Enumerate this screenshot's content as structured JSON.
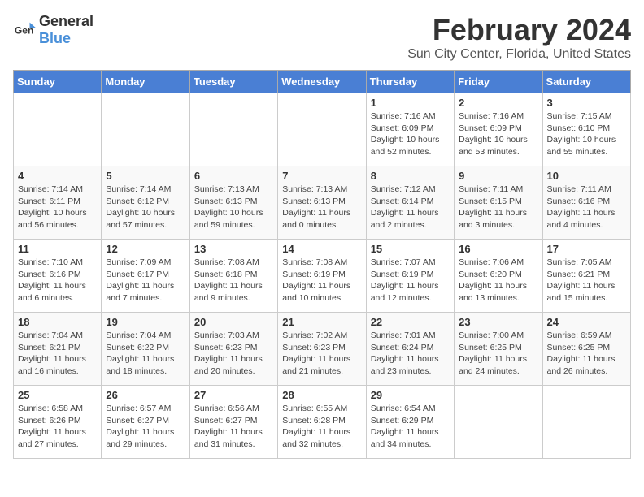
{
  "logo": {
    "general": "General",
    "blue": "Blue"
  },
  "title": "February 2024",
  "subtitle": "Sun City Center, Florida, United States",
  "headers": [
    "Sunday",
    "Monday",
    "Tuesday",
    "Wednesday",
    "Thursday",
    "Friday",
    "Saturday"
  ],
  "weeks": [
    [
      {
        "day": "",
        "info": ""
      },
      {
        "day": "",
        "info": ""
      },
      {
        "day": "",
        "info": ""
      },
      {
        "day": "",
        "info": ""
      },
      {
        "day": "1",
        "info": "Sunrise: 7:16 AM\nSunset: 6:09 PM\nDaylight: 10 hours\nand 52 minutes."
      },
      {
        "day": "2",
        "info": "Sunrise: 7:16 AM\nSunset: 6:09 PM\nDaylight: 10 hours\nand 53 minutes."
      },
      {
        "day": "3",
        "info": "Sunrise: 7:15 AM\nSunset: 6:10 PM\nDaylight: 10 hours\nand 55 minutes."
      }
    ],
    [
      {
        "day": "4",
        "info": "Sunrise: 7:14 AM\nSunset: 6:11 PM\nDaylight: 10 hours\nand 56 minutes."
      },
      {
        "day": "5",
        "info": "Sunrise: 7:14 AM\nSunset: 6:12 PM\nDaylight: 10 hours\nand 57 minutes."
      },
      {
        "day": "6",
        "info": "Sunrise: 7:13 AM\nSunset: 6:13 PM\nDaylight: 10 hours\nand 59 minutes."
      },
      {
        "day": "7",
        "info": "Sunrise: 7:13 AM\nSunset: 6:13 PM\nDaylight: 11 hours\nand 0 minutes."
      },
      {
        "day": "8",
        "info": "Sunrise: 7:12 AM\nSunset: 6:14 PM\nDaylight: 11 hours\nand 2 minutes."
      },
      {
        "day": "9",
        "info": "Sunrise: 7:11 AM\nSunset: 6:15 PM\nDaylight: 11 hours\nand 3 minutes."
      },
      {
        "day": "10",
        "info": "Sunrise: 7:11 AM\nSunset: 6:16 PM\nDaylight: 11 hours\nand 4 minutes."
      }
    ],
    [
      {
        "day": "11",
        "info": "Sunrise: 7:10 AM\nSunset: 6:16 PM\nDaylight: 11 hours\nand 6 minutes."
      },
      {
        "day": "12",
        "info": "Sunrise: 7:09 AM\nSunset: 6:17 PM\nDaylight: 11 hours\nand 7 minutes."
      },
      {
        "day": "13",
        "info": "Sunrise: 7:08 AM\nSunset: 6:18 PM\nDaylight: 11 hours\nand 9 minutes."
      },
      {
        "day": "14",
        "info": "Sunrise: 7:08 AM\nSunset: 6:19 PM\nDaylight: 11 hours\nand 10 minutes."
      },
      {
        "day": "15",
        "info": "Sunrise: 7:07 AM\nSunset: 6:19 PM\nDaylight: 11 hours\nand 12 minutes."
      },
      {
        "day": "16",
        "info": "Sunrise: 7:06 AM\nSunset: 6:20 PM\nDaylight: 11 hours\nand 13 minutes."
      },
      {
        "day": "17",
        "info": "Sunrise: 7:05 AM\nSunset: 6:21 PM\nDaylight: 11 hours\nand 15 minutes."
      }
    ],
    [
      {
        "day": "18",
        "info": "Sunrise: 7:04 AM\nSunset: 6:21 PM\nDaylight: 11 hours\nand 16 minutes."
      },
      {
        "day": "19",
        "info": "Sunrise: 7:04 AM\nSunset: 6:22 PM\nDaylight: 11 hours\nand 18 minutes."
      },
      {
        "day": "20",
        "info": "Sunrise: 7:03 AM\nSunset: 6:23 PM\nDaylight: 11 hours\nand 20 minutes."
      },
      {
        "day": "21",
        "info": "Sunrise: 7:02 AM\nSunset: 6:23 PM\nDaylight: 11 hours\nand 21 minutes."
      },
      {
        "day": "22",
        "info": "Sunrise: 7:01 AM\nSunset: 6:24 PM\nDaylight: 11 hours\nand 23 minutes."
      },
      {
        "day": "23",
        "info": "Sunrise: 7:00 AM\nSunset: 6:25 PM\nDaylight: 11 hours\nand 24 minutes."
      },
      {
        "day": "24",
        "info": "Sunrise: 6:59 AM\nSunset: 6:25 PM\nDaylight: 11 hours\nand 26 minutes."
      }
    ],
    [
      {
        "day": "25",
        "info": "Sunrise: 6:58 AM\nSunset: 6:26 PM\nDaylight: 11 hours\nand 27 minutes."
      },
      {
        "day": "26",
        "info": "Sunrise: 6:57 AM\nSunset: 6:27 PM\nDaylight: 11 hours\nand 29 minutes."
      },
      {
        "day": "27",
        "info": "Sunrise: 6:56 AM\nSunset: 6:27 PM\nDaylight: 11 hours\nand 31 minutes."
      },
      {
        "day": "28",
        "info": "Sunrise: 6:55 AM\nSunset: 6:28 PM\nDaylight: 11 hours\nand 32 minutes."
      },
      {
        "day": "29",
        "info": "Sunrise: 6:54 AM\nSunset: 6:29 PM\nDaylight: 11 hours\nand 34 minutes."
      },
      {
        "day": "",
        "info": ""
      },
      {
        "day": "",
        "info": ""
      }
    ]
  ]
}
